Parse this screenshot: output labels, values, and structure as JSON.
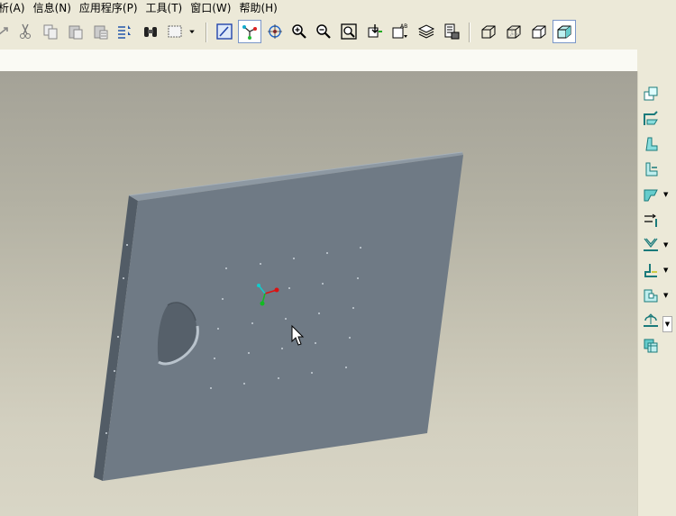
{
  "menu": {
    "items": [
      {
        "label": "析(A)"
      },
      {
        "label": "信息(N)"
      },
      {
        "label": "应用程序(P)"
      },
      {
        "label": "工具(T)"
      },
      {
        "label": "窗口(W)"
      },
      {
        "label": "帮助(H)"
      }
    ]
  },
  "toolbar": {
    "icons": [
      "regenerate-icon",
      "cut-icon",
      "copy-icon",
      "paste-icon",
      "paste-special-icon",
      "repaint-icon",
      "find-icon",
      "select-box-icon",
      "dropdown-arrow-icon",
      "view-toggle-icon",
      "datum-csys-icon",
      "spin-center-icon",
      "zoom-in-icon",
      "zoom-out-icon",
      "refit-icon",
      "orient-icon",
      "saved-views-icon",
      "layers-icon",
      "view-manager-icon",
      "wireframe-icon",
      "hidden-line-icon",
      "no-hidden-icon",
      "shading-icon"
    ],
    "pressed": [
      "datum-csys-icon",
      "shading-icon"
    ]
  },
  "right_toolbar": {
    "icons": [
      "unbend-icon",
      "flat-wall-icon",
      "flange-wall-icon",
      "extend-wall-icon",
      "bend-icon",
      "rip-icon",
      "form-icon",
      "edge-bend-icon",
      "corner-relief-icon",
      "flatten-form-icon",
      "conversion-icon"
    ]
  },
  "colors": {
    "sheet_face": "#6f7a85",
    "sheet_edge": "#525c66",
    "csys_red": "#dd1111",
    "csys_green": "#11bb22",
    "csys_cyan": "#11cccc"
  }
}
